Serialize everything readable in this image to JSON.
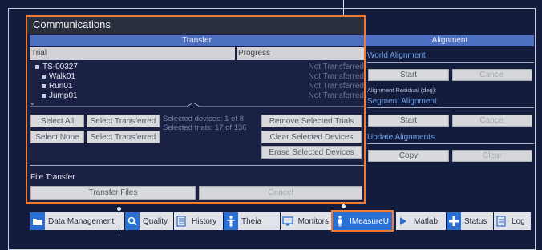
{
  "communications": {
    "title": "Communications",
    "transfer": {
      "header": "Transfer",
      "columns": [
        "Trial",
        "Progress"
      ],
      "trials": [
        {
          "label": "TS-00327",
          "status": "Not Transferred"
        },
        {
          "label": "Walk01",
          "status": "Not Transferred"
        },
        {
          "label": "Run01",
          "status": "Not Transferred"
        },
        {
          "label": "Jump01",
          "status": "Not Transferred"
        }
      ],
      "selected_devices": "Selected devices: 1 of 8",
      "selected_trials": "Selected trials: 17 of 136",
      "buttons": {
        "select_all": "Select All",
        "select_transferred_1": "Select Transferred",
        "select_none": "Select None",
        "select_transferred_2": "Select Transferred",
        "remove_selected_trials": "Remove Selected Trials",
        "clear_selected_devices": "Clear Selected Devices",
        "erase_selected_devices": "Erase Selected Devices"
      }
    },
    "file_transfer": {
      "label": "File Transfer",
      "transfer_files": "Transfer Files",
      "cancel": "Cancel"
    }
  },
  "alignment": {
    "header": "Alignment",
    "world_alignment": "World Alignment",
    "world_start": "Start",
    "world_cancel": "Cancel",
    "residual_label": "Alignment Residual (deg):",
    "segment_alignment": "Segment Alignment",
    "segment_start": "Start",
    "segment_cancel": "Cancel",
    "update_alignments": "Update Alignments",
    "copy": "Copy",
    "clear": "Clear"
  },
  "tabs": [
    {
      "label": "Data Management",
      "icon": "folder-icon"
    },
    {
      "label": "Quality",
      "icon": "search-icon"
    },
    {
      "label": "History",
      "icon": "document-icon"
    },
    {
      "label": "Theia",
      "icon": "person-icon"
    },
    {
      "label": "Monitors",
      "icon": "monitor-icon"
    },
    {
      "label": "IMeasureU",
      "icon": "sensor-person-icon"
    },
    {
      "label": "Matlab",
      "icon": "play-icon"
    },
    {
      "label": "Status",
      "icon": "plus-icon"
    },
    {
      "label": "Log",
      "icon": "log-icon"
    }
  ],
  "colors": {
    "background": "#141c3d",
    "accent_blue": "#4d70c0",
    "highlight_orange": "#f07a30"
  }
}
